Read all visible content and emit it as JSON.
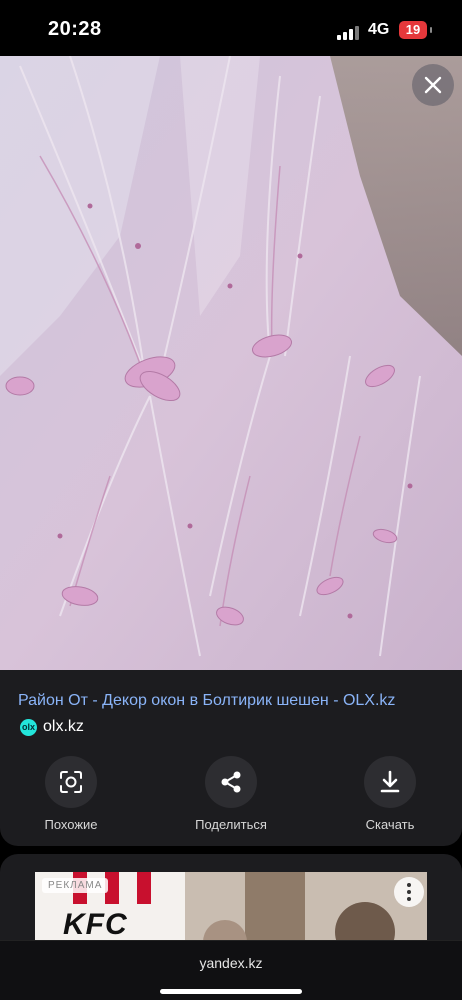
{
  "status_bar": {
    "time": "20:28",
    "network": "4G",
    "battery": "19",
    "battery_color": "#e5383b"
  },
  "image_viewer": {
    "close_icon": "close-icon"
  },
  "result": {
    "title": "Район От - Декор окон в Болтирик шешен - OLX.kz",
    "source": "olx.kz",
    "source_logo_text": "olx",
    "title_color": "#8ab4f8"
  },
  "actions": [
    {
      "label": "Похожие",
      "icon": "lens-search-icon"
    },
    {
      "label": "Поделиться",
      "icon": "share-icon"
    },
    {
      "label": "Скачать",
      "icon": "download-icon"
    }
  ],
  "ad": {
    "badge": "РЕКЛАМА",
    "brand": "KFC"
  },
  "browser": {
    "url": "yandex.kz"
  }
}
